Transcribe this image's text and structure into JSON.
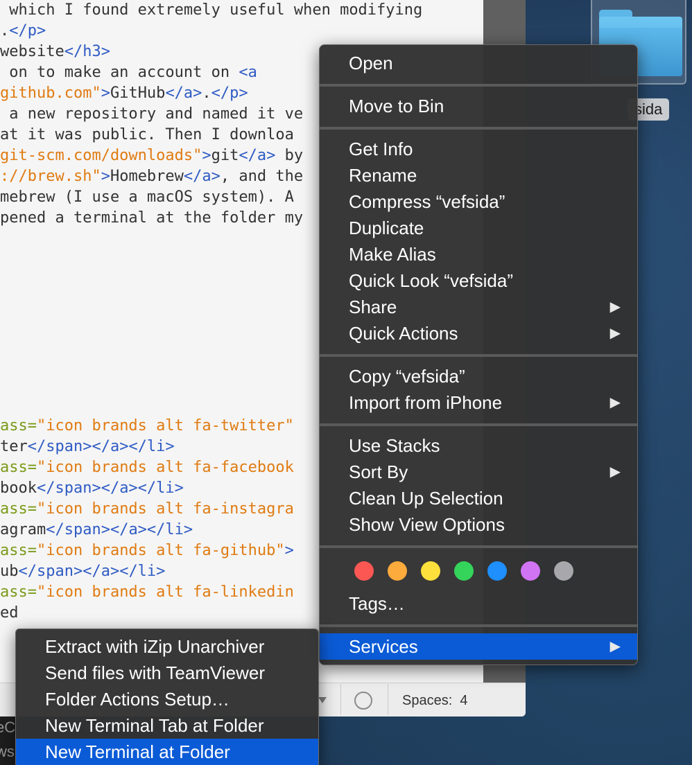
{
  "desktop": {
    "folder_label": "sida"
  },
  "editor": {
    "code_lines": [
      [
        {
          "t": "text",
          "v": " which I found extremely useful when modifying"
        }
      ],
      [
        {
          "t": "text",
          "v": "."
        },
        {
          "t": "tag",
          "v": "</p>"
        }
      ],
      [
        {
          "t": "text",
          "v": "website"
        },
        {
          "t": "tag",
          "v": "</h3>"
        }
      ],
      [
        {
          "t": "text",
          "v": " on to make an account on "
        },
        {
          "t": "tag",
          "v": "<a"
        }
      ],
      [
        {
          "t": "str",
          "v": "github.com\""
        },
        {
          "t": "tag",
          "v": ">"
        },
        {
          "t": "text",
          "v": "GitHub"
        },
        {
          "t": "tag",
          "v": "</a>"
        },
        {
          "t": "text",
          "v": "."
        },
        {
          "t": "tag",
          "v": "</p>"
        }
      ],
      [
        {
          "t": "text",
          "v": " a new repository and named it ve"
        }
      ],
      [
        {
          "t": "text",
          "v": "at it was public. Then I downloa"
        }
      ],
      [
        {
          "t": "str",
          "v": "git-scm.com/downloads\""
        },
        {
          "t": "tag",
          "v": ">"
        },
        {
          "t": "text",
          "v": "git"
        },
        {
          "t": "tag",
          "v": "</a>"
        },
        {
          "t": "text",
          "v": " by"
        }
      ],
      [
        {
          "t": "str",
          "v": "://brew.sh\""
        },
        {
          "t": "tag",
          "v": ">"
        },
        {
          "t": "text",
          "v": "Homebrew"
        },
        {
          "t": "tag",
          "v": "</a>"
        },
        {
          "t": "text",
          "v": ", and the"
        }
      ],
      [
        {
          "t": "text",
          "v": "mebrew (I use a macOS system). A"
        }
      ],
      [
        {
          "t": "text",
          "v": "pened a terminal at the folder my"
        }
      ],
      [],
      [],
      [],
      [],
      [],
      [],
      [],
      [],
      [],
      [
        {
          "t": "attr",
          "v": "ass="
        },
        {
          "t": "str",
          "v": "\"icon brands alt fa-twitter\""
        }
      ],
      [
        {
          "t": "text",
          "v": "ter"
        },
        {
          "t": "tag",
          "v": "</span></a></li>"
        }
      ],
      [
        {
          "t": "attr",
          "v": "ass="
        },
        {
          "t": "str",
          "v": "\"icon brands alt fa-facebook"
        }
      ],
      [
        {
          "t": "text",
          "v": "book"
        },
        {
          "t": "tag",
          "v": "</span></a></li>"
        }
      ],
      [
        {
          "t": "attr",
          "v": "ass="
        },
        {
          "t": "str",
          "v": "\"icon brands alt fa-instagra"
        }
      ],
      [
        {
          "t": "text",
          "v": "agram"
        },
        {
          "t": "tag",
          "v": "</span></a></li>"
        }
      ],
      [
        {
          "t": "attr",
          "v": "ass="
        },
        {
          "t": "str",
          "v": "\"icon brands alt fa-github\""
        },
        {
          "t": "tag",
          "v": ">"
        }
      ],
      [
        {
          "t": "text",
          "v": "ub"
        },
        {
          "t": "tag",
          "v": "</span></a></li>"
        }
      ],
      [
        {
          "t": "attr",
          "v": "ass="
        },
        {
          "t": "str",
          "v": "\"icon brands alt fa-linkedin"
        }
      ],
      [
        {
          "t": "text",
          "v": "ed"
        }
      ]
    ],
    "status": {
      "spaces": "Spaces:  4"
    }
  },
  "terminal_strip": {
    "line1": "eC",
    "line2": "ws"
  },
  "context_menu": {
    "items": [
      {
        "label": "Open",
        "submenu": false
      },
      {
        "label": "Move to Bin",
        "submenu": false
      },
      {
        "label": "Get Info",
        "submenu": false
      },
      {
        "label": "Rename",
        "submenu": false
      },
      {
        "label": "Compress “vefsida”",
        "submenu": false
      },
      {
        "label": "Duplicate",
        "submenu": false
      },
      {
        "label": "Make Alias",
        "submenu": false
      },
      {
        "label": "Quick Look “vefsida”",
        "submenu": false
      },
      {
        "label": "Share",
        "submenu": true
      },
      {
        "label": "Quick Actions",
        "submenu": true
      },
      {
        "label": "Copy “vefsida”",
        "submenu": false
      },
      {
        "label": "Import from iPhone",
        "submenu": true
      },
      {
        "label": "Use Stacks",
        "submenu": false
      },
      {
        "label": "Sort By",
        "submenu": true
      },
      {
        "label": "Clean Up Selection",
        "submenu": false
      },
      {
        "label": "Show View Options",
        "submenu": false
      },
      {
        "label": "Tags…",
        "submenu": false
      },
      {
        "label": "Services",
        "submenu": true
      }
    ],
    "submenu_arrow": "▶",
    "tag_colors": [
      "#fc5753",
      "#fdab3c",
      "#fde03c",
      "#34d45a",
      "#1e8ffc",
      "#d074f4",
      "#a8a8ac"
    ],
    "tag_names": [
      "red-tag",
      "orange-tag",
      "yellow-tag",
      "green-tag",
      "blue-tag",
      "purple-tag",
      "gray-tag"
    ],
    "highlight_color": "#0b5bd6"
  },
  "services_menu": {
    "items": [
      "Extract with iZip Unarchiver",
      "Send files with TeamViewer",
      "Folder Actions Setup…",
      "New Terminal Tab at Folder",
      "New Terminal at Folder"
    ]
  }
}
